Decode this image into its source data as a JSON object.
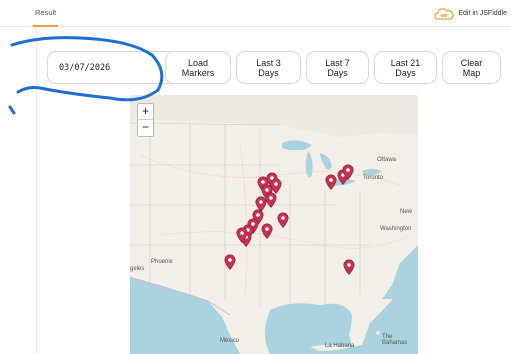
{
  "header": {
    "tab_result": "Result",
    "edit_link": "Edit in JSFiddle"
  },
  "controls": {
    "date_value": "03/07/2026",
    "buttons": [
      {
        "label": "Load\nMarkers"
      },
      {
        "label": "Last 3\nDays"
      },
      {
        "label": "Last 7\nDays"
      },
      {
        "label": "Last 21\nDays"
      },
      {
        "label": "Clear\nMap"
      }
    ]
  },
  "map": {
    "zoom_in": "+",
    "zoom_out": "−",
    "labels": {
      "ottawa": "Ottawa",
      "toronto": "Toronto",
      "new": "New",
      "washington": "Washington",
      "phoenix": "Phoenix",
      "angeles": "geles",
      "mexico": "México",
      "habana": "La Habana",
      "bahamas": "The Bahamas"
    }
  },
  "colors": {
    "accent": "#f0a13a",
    "marker": "#c8314f",
    "annotation": "#1d6fd6"
  }
}
